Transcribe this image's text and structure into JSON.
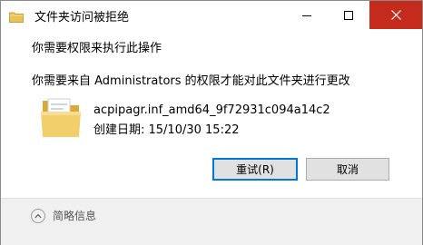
{
  "window": {
    "title": "文件夹访问被拒绝",
    "title_icon": "folder-shield-icon",
    "controls": {
      "minimize_icon": "minimize-icon",
      "maximize_icon": "maximize-icon",
      "close_icon": "close-icon"
    }
  },
  "dialog": {
    "heading": "你需要权限来执行此操作",
    "message": "你需要来自 Administrators 的权限才能对此文件夹进行更改",
    "item": {
      "icon": "folder-icon",
      "name": "acpipagr.inf_amd64_9f72931c094a14c2",
      "created": "创建日期: 15/10/30 15:22"
    },
    "buttons": {
      "retry_label": "重试(R)",
      "cancel_label": "取消"
    }
  },
  "footer": {
    "details_label": "简略信息",
    "toggle_icon": "chevron-up-icon"
  },
  "colors": {
    "close_button": "#c42b1c",
    "focus_border": "#0078d7",
    "footer_bg": "#f0f0f0",
    "folder": "#e8c25a"
  }
}
